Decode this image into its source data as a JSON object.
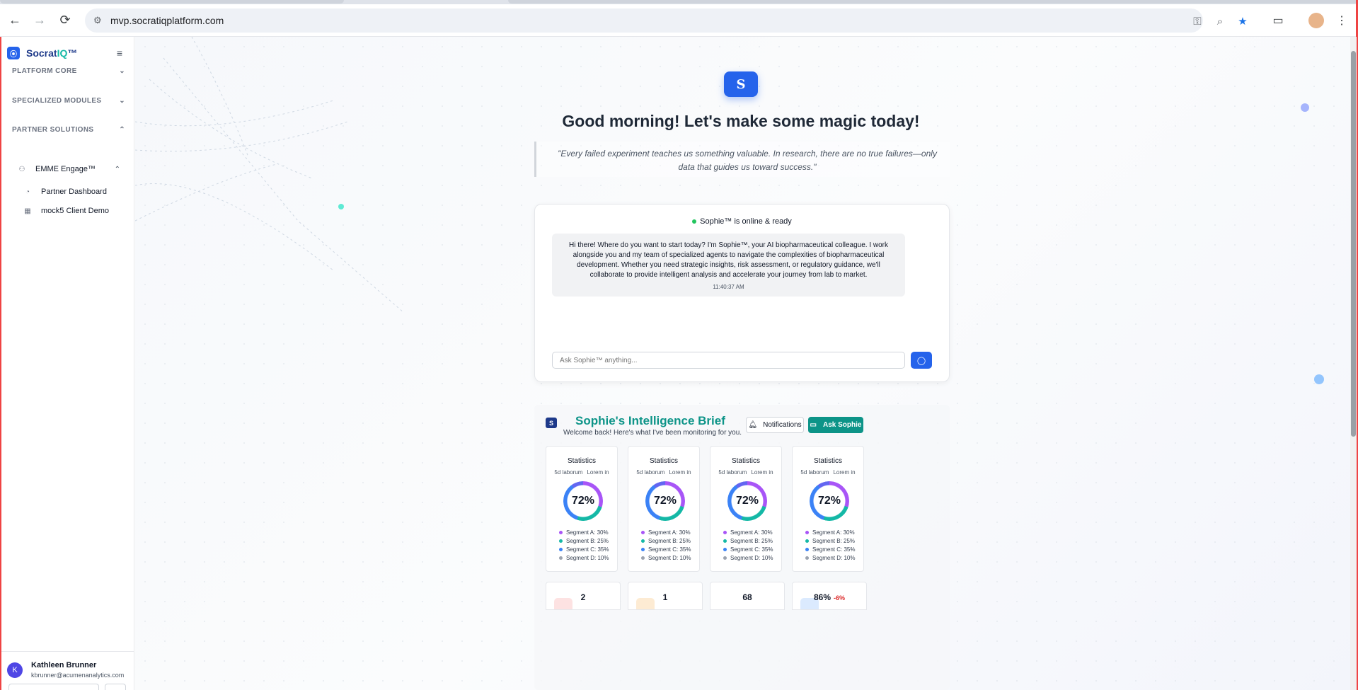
{
  "browser": {
    "url": "mvp.socratiqplatform.com"
  },
  "sidebar": {
    "brand_prefix": "Socrat",
    "brand_accent": "IQ",
    "brand_suffix": "™",
    "sections": [
      {
        "label": "PLATFORM CORE",
        "expanded": false
      },
      {
        "label": "SPECIALIZED MODULES",
        "expanded": false
      },
      {
        "label": "PARTNER SOLUTIONS",
        "expanded": true
      }
    ],
    "group": {
      "label": "EMME Engage™",
      "expanded": true
    },
    "items": [
      {
        "label": "Partner Dashboard",
        "icon": "gauge-icon"
      },
      {
        "label": "mock5 Client Demo",
        "icon": "building-icon"
      }
    ],
    "user": {
      "initial": "K",
      "name": "Kathleen Brunner",
      "email": "kbrunner@acumenanalytics.com"
    }
  },
  "hero": {
    "logo_letter": "S",
    "greeting": "Good morning! Let's make some magic today!",
    "quote": "\"Every failed experiment teaches us something valuable. In research, there are no true failures—only data that guides us toward success.\""
  },
  "chat": {
    "status": "Sophie™ is online & ready",
    "message": "Hi there! Where do you want to start today? I'm Sophie™, your AI biopharmaceutical colleague. I work alongside you and my team of specialized agents to navigate the complexities of biopharmaceutical development. Whether you need strategic insights, risk assessment, or regulatory guidance, we'll collaborate to provide intelligent analysis and accelerate your journey from lab to market.",
    "timestamp": "11:40:37 AM",
    "input_placeholder": "Ask Sophie™ anything..."
  },
  "brief": {
    "logo_letter": "S",
    "title": "Sophie's Intelligence Brief",
    "subtitle": "Welcome back! Here's what I've been monitoring for you.",
    "notifications_label": "Notifications",
    "ask_label": "Ask Sophie",
    "stat_cards": [
      {
        "title": "Statistics",
        "meta_a": "5d laborum",
        "meta_b": "Lorem in",
        "value": "72%"
      },
      {
        "title": "Statistics",
        "meta_a": "5d laborum",
        "meta_b": "Lorem in",
        "value": "72%"
      },
      {
        "title": "Statistics",
        "meta_a": "5d laborum",
        "meta_b": "Lorem in",
        "value": "72%"
      },
      {
        "title": "Statistics",
        "meta_a": "5d laborum",
        "meta_b": "Lorem in",
        "value": "72%"
      }
    ],
    "segments": [
      {
        "label": "Segment A: 30%",
        "color": "#a855f7"
      },
      {
        "label": "Segment B: 25%",
        "color": "#14b8a6"
      },
      {
        "label": "Segment C: 35%",
        "color": "#3b82f6"
      },
      {
        "label": "Segment D: 10%",
        "color": "#9ca3af"
      }
    ],
    "mini_cards": [
      {
        "value": "2",
        "delta": "",
        "badge_color": "#fde2e2"
      },
      {
        "value": "1",
        "delta": "",
        "badge_color": "#fdebd3"
      },
      {
        "value": "68",
        "delta": "",
        "badge_color": ""
      },
      {
        "value": "86%",
        "delta": "-6%",
        "badge_color": "#dbeafe"
      }
    ]
  },
  "colors": {
    "primary": "#2563eb",
    "teal": "#0d9488",
    "online": "#22c55e"
  }
}
